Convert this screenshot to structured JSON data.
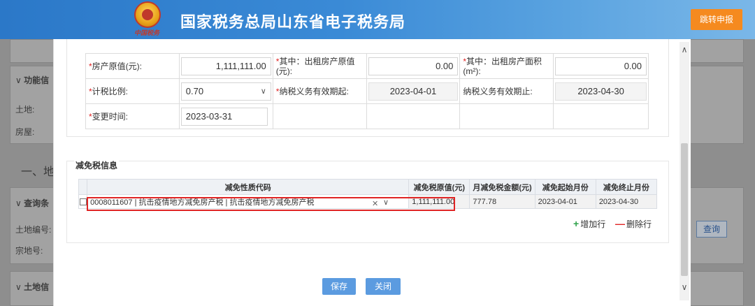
{
  "header": {
    "site_title": "国家税务总局山东省电子税务局",
    "seal_text": "中国税务",
    "jump_button": "跳转申报"
  },
  "background_page": {
    "section_function": "功能信",
    "land_label": "土地:",
    "house_label": "房屋:",
    "section_one": "一、地",
    "section_query": "查询条",
    "land_number_label": "土地编号:",
    "parcel_number_label": "宗地号:",
    "section_land_info": "土地信",
    "query_button": "查询"
  },
  "form": {
    "original_value_label": "房产原值(元):",
    "original_value": "1,111,111.00",
    "rental_original_label": "其中：出租房产原值(元):",
    "rental_original_value": "0.00",
    "rental_area_label": "其中：出租房产面积(m²):",
    "rental_area_value": "0.00",
    "tax_ratio_label": "计税比例:",
    "tax_ratio_value": "0.70",
    "period_start_label": "纳税义务有效期起:",
    "period_start_value": "2023-04-01",
    "period_end_label": "纳税义务有效期止:",
    "period_end_value": "2023-04-30",
    "change_time_label": "变更时间:",
    "change_time_value": "2023-03-31"
  },
  "exemption": {
    "section_title": "减免税信息",
    "columns": [
      "减免性质代码",
      "减免税原值(元)",
      "月减免税金额(元)",
      "减免起始月份",
      "减免终止月份"
    ],
    "rows": [
      {
        "code": "0008011607 | 抗击疫情地方减免房产税 | 抗击疫情地方减免房产税",
        "original_value": "1,111,111.00",
        "monthly_amount": "777.78",
        "start_month": "2023-04-01",
        "end_month": "2023-04-30"
      }
    ],
    "add_row_label": "增加行",
    "delete_row_label": "删除行"
  },
  "footer": {
    "save_label": "保存",
    "close_label": "关闭"
  },
  "colors": {
    "header_blue": "#2b78c8",
    "jump_orange": "#f58a1f",
    "primary_button": "#5b9be0",
    "highlight_red": "#e02424"
  }
}
